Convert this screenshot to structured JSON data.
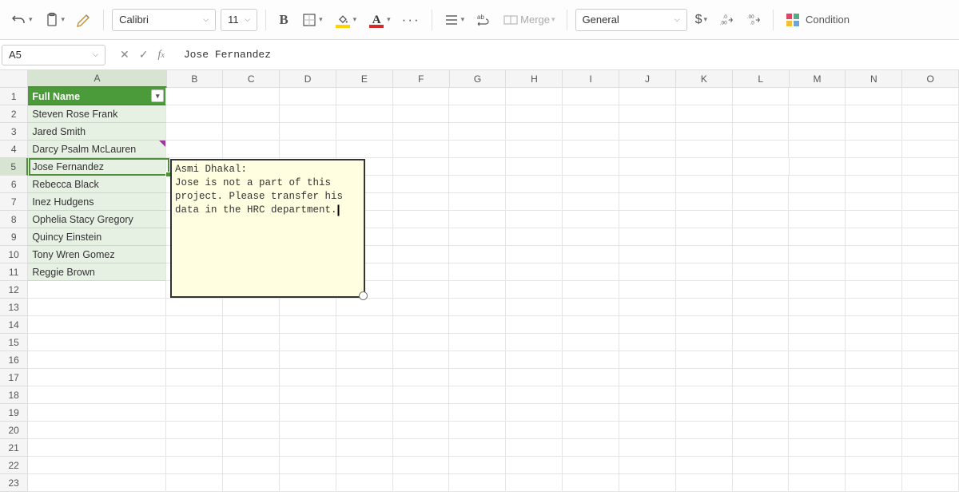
{
  "toolbar": {
    "font_name": "Calibri",
    "font_size": "11",
    "merge_label": "Merge",
    "number_format": "General",
    "cond_label": "Condition",
    "colors": {
      "highlight": "#ffd400",
      "fontcolor": "#d32a2a"
    }
  },
  "formula_bar": {
    "cell_ref": "A5",
    "value": "Jose  Fernandez"
  },
  "columns": [
    "A",
    "B",
    "C",
    "D",
    "E",
    "F",
    "G",
    "H",
    "I",
    "J",
    "K",
    "L",
    "M",
    "N",
    "O"
  ],
  "row_count": 23,
  "active_col": "A",
  "active_row": 5,
  "table": {
    "header": "Full Name",
    "names": [
      "Steven Rose Frank",
      "Jared  Smith",
      "Darcy Psalm McLauren",
      "Jose  Fernandez",
      "Rebecca  Black",
      "Inez  Hudgens",
      "Ophelia Stacy Gregory",
      "Quincy  Einstein",
      "Tony Wren Gomez",
      "Reggie  Brown"
    ],
    "comment_on_row": 4
  },
  "comment": {
    "author": "Asmi Dhakal:",
    "body": "Jose is not a part of this project. Please transfer his data in the HRC department."
  }
}
